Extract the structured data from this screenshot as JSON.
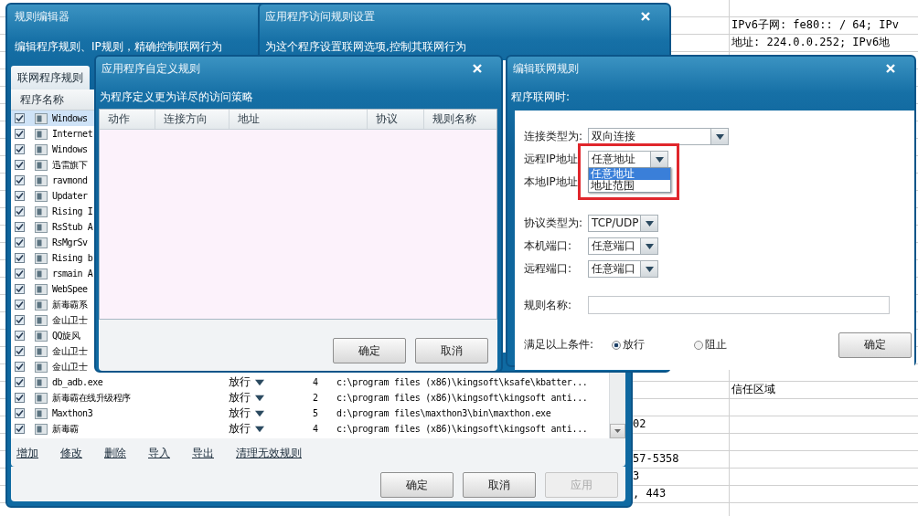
{
  "background_sheet": {
    "rows": [
      {
        "column_2": "IPv6子网: fe80:: / 64; IPv"
      },
      {
        "column_2": "地址: 224.0.0.252; IPv6地"
      },
      {},
      {},
      {},
      {},
      {},
      {},
      {},
      {},
      {},
      {},
      {},
      {},
      {},
      {},
      {},
      {},
      {},
      {},
      {},
      {
        "column_2": "信任区域"
      },
      {},
      {
        "column_1": "02"
      },
      {},
      {
        "column_1": "57-5358"
      },
      {
        "column_1": "3"
      },
      {
        "column_1": ", 443"
      }
    ]
  },
  "rule_editor": {
    "title": "规则编辑器",
    "subtitle": "编辑程序规则、IP规则，精确控制联网行为",
    "tabs": [
      {
        "label": "联网程序规则",
        "selected": true
      }
    ],
    "columns": [
      "程序名称"
    ],
    "rows": [
      {
        "name": "Windows",
        "checked": true,
        "selected": true
      },
      {
        "name": "Internet",
        "checked": true,
        "selected": false
      },
      {
        "name": "Windows",
        "checked": true,
        "selected": false
      },
      {
        "name": "迅雷旗下",
        "checked": true,
        "selected": false
      },
      {
        "name": "ravmond",
        "checked": true,
        "selected": false
      },
      {
        "name": "Updater",
        "checked": true,
        "selected": false
      },
      {
        "name": "Rising I",
        "checked": true,
        "selected": false
      },
      {
        "name": "RsStub A",
        "checked": true,
        "selected": false
      },
      {
        "name": "RsMgrSv",
        "checked": true,
        "selected": false
      },
      {
        "name": "Rising b",
        "checked": true,
        "selected": false
      },
      {
        "name": "rsmain A",
        "checked": true,
        "selected": false
      },
      {
        "name": "WebSpee",
        "checked": true,
        "selected": false
      },
      {
        "name": "新毒霸系",
        "checked": true,
        "selected": false
      },
      {
        "name": "金山卫士",
        "checked": true,
        "selected": false
      },
      {
        "name": "QQ旋风",
        "checked": true,
        "selected": false
      },
      {
        "name": "金山卫士",
        "checked": true,
        "selected": false
      },
      {
        "name": "金山卫士",
        "checked": true,
        "selected": false
      },
      {
        "name": "db_adb.exe",
        "checked": true,
        "selected": false,
        "action": "放行",
        "count": "4",
        "path": "c:\\program files (x86)\\kingsoft\\ksafe\\kbatter..."
      },
      {
        "name": "新毒霸在线升级程序",
        "checked": true,
        "selected": false,
        "action": "放行",
        "count": "2",
        "path": "c:\\program files (x86)\\kingsoft\\kingsoft anti..."
      },
      {
        "name": "Maxthon3",
        "checked": true,
        "selected": false,
        "action": "放行",
        "count": "5",
        "path": "d:\\program files\\maxthon3\\bin\\maxthon.exe"
      },
      {
        "name": "新毒霸",
        "checked": true,
        "selected": false,
        "action": "放行",
        "count": "4",
        "path": "c:\\program files (x86)\\kingsoft\\kingsoft anti..."
      }
    ],
    "links": [
      "增加",
      "修改",
      "删除",
      "导入",
      "导出",
      "清理无效规则"
    ],
    "buttons": [
      {
        "label": "确定",
        "disabled": false
      },
      {
        "label": "取消",
        "disabled": false
      },
      {
        "label": "应用",
        "disabled": true
      }
    ]
  },
  "access_settings": {
    "title": "应用程序访问规则设置",
    "subtitle": "为这个程序设置联网选项,控制其联网行为"
  },
  "custom_rules": {
    "title": "应用程序自定义规则",
    "subtitle": "为程序定义更为详尽的访问策略",
    "columns": [
      "动作",
      "连接方向",
      "地址",
      "协议",
      "规则名称"
    ],
    "buttons": [
      "确定",
      "取消"
    ]
  },
  "edit_rule": {
    "title": "编辑联网规则",
    "subtitle": "程序联网时:",
    "fields": [
      {
        "kind": "combo",
        "label": "连接类型为:",
        "value": "双向连接"
      },
      {
        "kind": "combo",
        "label": "远程IP地址",
        "value": "任意地址",
        "options": [
          {
            "label": "任意地址",
            "selected": true
          },
          {
            "label": "地址范围",
            "selected": false
          }
        ]
      },
      {
        "kind": "label",
        "label": "本地IP地址"
      },
      {
        "kind": "combo",
        "label": "协议类型为:",
        "value": "TCP/UDP"
      },
      {
        "kind": "combo",
        "label": "本机端口:",
        "value": "任意端口"
      },
      {
        "kind": "combo",
        "label": "远程端口:",
        "value": "任意端口"
      },
      {
        "kind": "text",
        "label": "规则名称:"
      }
    ],
    "condition": {
      "label": "满足以上条件:",
      "options": [
        {
          "label": "放行",
          "selected": true
        },
        {
          "label": "阻止",
          "selected": false
        }
      ]
    },
    "button": "确定"
  }
}
